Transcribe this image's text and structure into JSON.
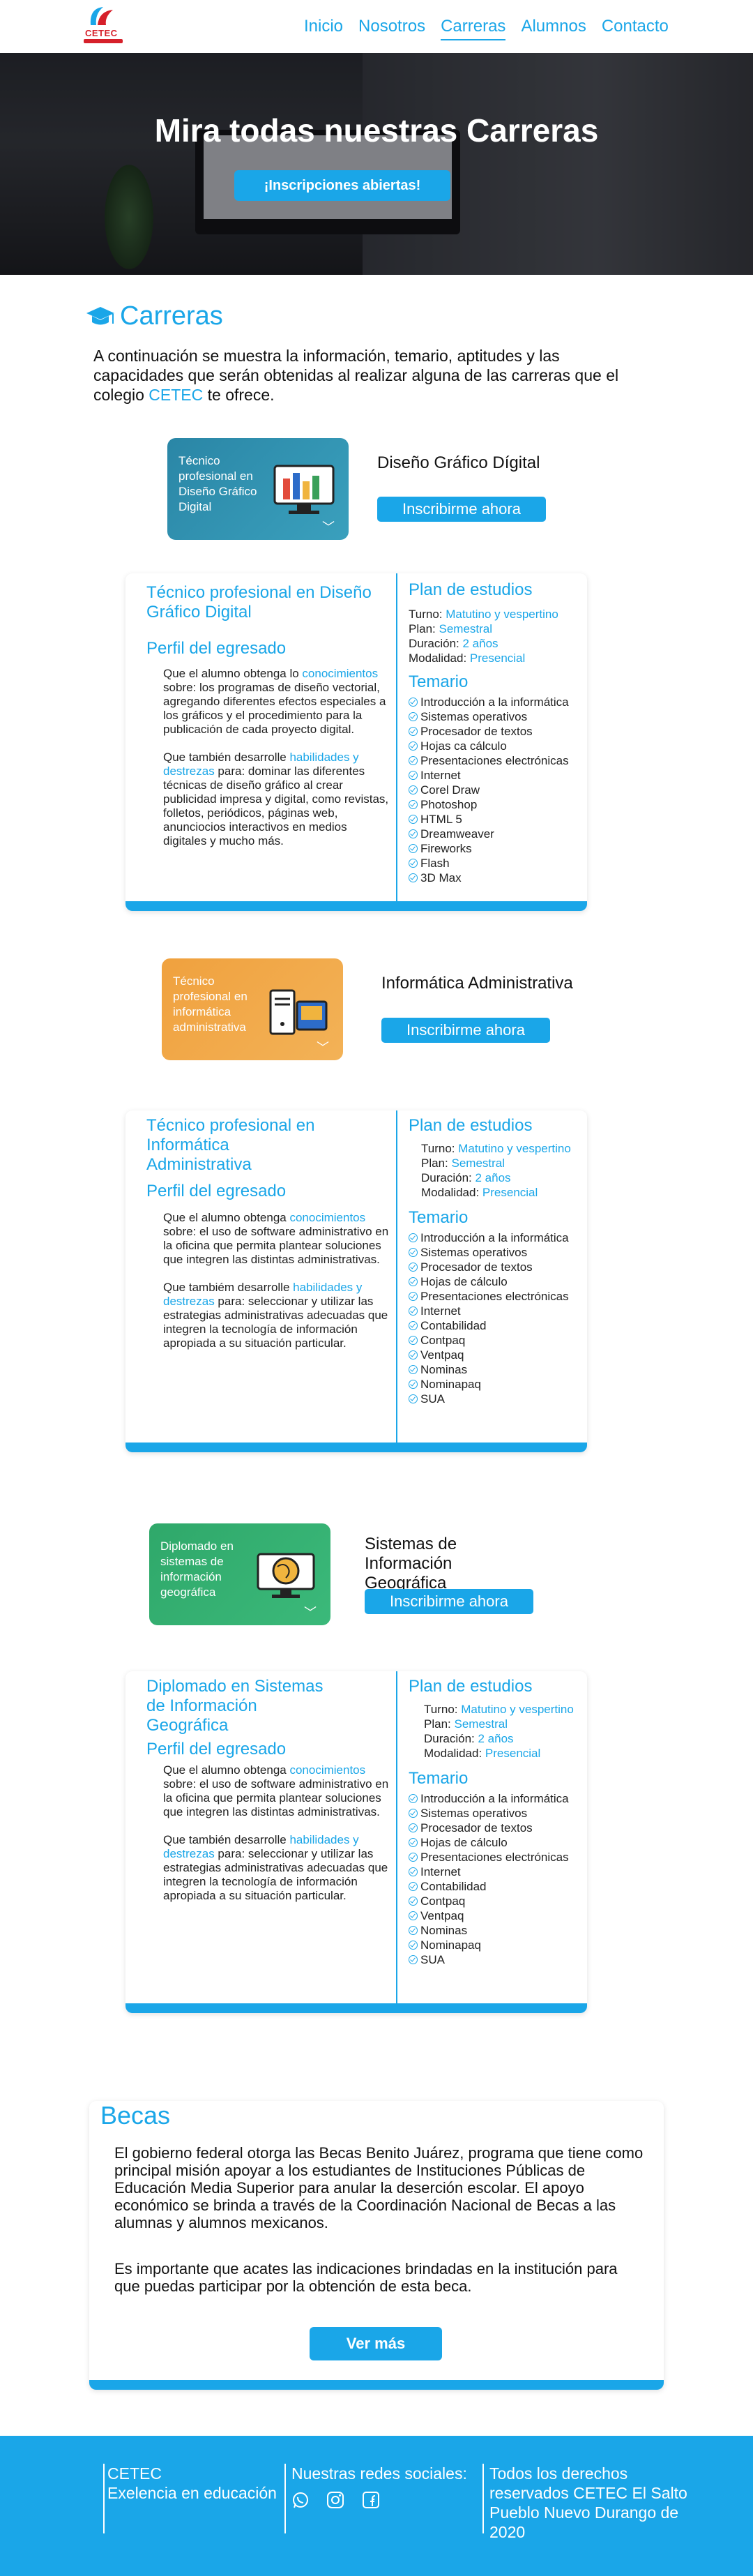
{
  "logo": {
    "text": "CETEC"
  },
  "nav": {
    "items": [
      "Inicio",
      "Nosotros",
      "Carreras",
      "Alumnos",
      "Contacto"
    ],
    "active": "Carreras"
  },
  "hero": {
    "title": "Mira todas nuestras Carreras",
    "cta": "¡Inscripciones abiertas!"
  },
  "section": {
    "title": "Carreras",
    "intro_before": "A continuación se muestra la información, temario, aptitudes y las capacidades que serán obtenidas al realizar alguna de las carreras que el colegio ",
    "intro_highlight": "CETEC",
    "intro_after": " te ofrece."
  },
  "colors": {
    "accent": "#1aa6e8",
    "card1": "#2a86a6",
    "card2": "#f0a13e",
    "card3": "#2fa86a"
  },
  "programs": [
    {
      "card_label": "Técnico profesional en Diseño Gráfico Digital",
      "card_icon": "design-tools-icon",
      "name": "Diseño Gráfico Dígital",
      "enroll": "Inscribirme ahora",
      "title": "Técnico profesional en Diseño Gráfico Digital",
      "profile_title": "Perfil del egresado",
      "p1_before": "Que el alumno obtenga lo ",
      "p1_highlight": "conocimientos",
      "p1_after": " sobre: los programas de diseño vectorial, agregando diferentes efectos especiales a los gráficos y el procedimiento para la publicación de cada proyecto digital.",
      "p2_before": "Que también desarrolle ",
      "p2_highlight": "habilidades y destrezas",
      "p2_after": " para: dominar las diferentes técnicas de diseño gráfico al crear publicidad impresa y digital, como revistas, folletos, periódicos, páginas web, anunciocios interactivos en medios digitales y mucho más.",
      "plan_title": "Plan de estudios",
      "turno_label": "Turno:",
      "turno": "Matutino y vespertino",
      "plan_label": "Plan:",
      "plan": "Semestral",
      "duracion_label": "Duración:",
      "duracion": "2 años",
      "modalidad_label": "Modalidad:",
      "modalidad": "Presencial",
      "temario_title": "Temario",
      "temario": [
        "Introducción a la informática",
        "Sistemas operativos",
        "Procesador de textos",
        "Hojas ca cálculo",
        "Presentaciones electrónicas",
        "Internet",
        "Corel Draw",
        "Photoshop",
        "HTML 5",
        "Dreamweaver",
        "Fireworks",
        "Flash",
        "3D Max"
      ]
    },
    {
      "card_label": "Técnico profesional en informática administrativa",
      "card_icon": "computer-icon",
      "name": "Informática Administrativa",
      "enroll": "Inscribirme ahora",
      "title": "Técnico profesional en Informática Administrativa",
      "profile_title": "Perfil del egresado",
      "p1_before": "Que el alumno obtenga ",
      "p1_highlight": "conocimientos",
      "p1_after": " sobre: el uso de software administrativo en la oficina que permita  plantear soluciones que integren las distintas administrativas.",
      "p2_before": "Que tambiém desarrolle ",
      "p2_highlight": "habilidades y destrezas",
      "p2_after": " para: seleccionar y utilizar las estrategias administrativas adecuadas que integren la tecnología de información apropiada a su situación particular.",
      "plan_title": "Plan de estudios",
      "turno_label": "Turno:",
      "turno": "Matutino y vespertino",
      "plan_label": "Plan:",
      "plan": "Semestral",
      "duracion_label": "Duración:",
      "duracion": "2 años",
      "modalidad_label": "Modalidad:",
      "modalidad": "Presencial",
      "temario_title": "Temario",
      "temario": [
        "Introducción a la informática",
        "Sistemas operativos",
        "Procesador de textos",
        "Hojas de cálculo",
        "Presentaciones electrónicas",
        "Internet",
        "Contabilidad",
        "Contpaq",
        "Ventpaq",
        "Nominas",
        "Nominapaq",
        "SUA"
      ]
    },
    {
      "card_label": "Diplomado en sistemas de información geográfica",
      "card_icon": "globe-monitor-icon",
      "name": "Sistemas de Información Geográfica",
      "enroll": "Inscribirme ahora",
      "title": "Diplomado en Sistemas de Información Geográfica",
      "profile_title": "Perfil del egresado",
      "p1_before": "Que el alumno obtenga ",
      "p1_highlight": "conocimientos",
      "p1_after": " sobre: el uso de software administrativo en la oficina que permita  plantear soluciones que integren las distintas administrativas.",
      "p2_before": "Que también desarrolle ",
      "p2_highlight": "habilidades y destrezas",
      "p2_after": " para: seleccionar y utilizar las estrategias administrativas adecuadas que integren la tecnología de información apropiada a su situación particular.",
      "plan_title": "Plan de estudios",
      "turno_label": "Turno:",
      "turno": "Matutino y vespertino",
      "plan_label": "Plan:",
      "plan": "Semestral",
      "duracion_label": "Duración:",
      "duracion": "2 años",
      "modalidad_label": "Modalidad:",
      "modalidad": "Presencial",
      "temario_title": "Temario",
      "temario": [
        "Introducción a la informática",
        "Sistemas operativos",
        "Procesador de textos",
        "Hojas de cálculo",
        "Presentaciones electrónicas",
        "Internet",
        "Contabilidad",
        "Contpaq",
        "Ventpaq",
        "Nominas",
        "Nominapaq",
        "SUA"
      ]
    }
  ],
  "becas": {
    "title": "Becas",
    "p1": "El gobierno federal otorga las Becas Benito Juárez, programa que tiene como principal misión apoyar a los estudiantes de Instituciones Públicas de Educación Media Superior para anular la deserción escolar. El apoyo económico se brinda a través de la Coordinación Nacional de Becas a las alumnas y alumnos mexicanos.",
    "p2": "Es importante que acates las indicaciones brindadas en la institución para que puedas participar por la obtención de esta beca.",
    "more": "Ver más"
  },
  "footer": {
    "brand": "CETEC",
    "slogan": "Exelencia en educación",
    "social_title": "Nuestras redes sociales:",
    "social_icons": [
      "whatsapp-icon",
      "instagram-icon",
      "facebook-icon"
    ],
    "rights": "Todos los derechos reservados  CETEC El Salto Pueblo Nuevo Durango de 2020"
  }
}
